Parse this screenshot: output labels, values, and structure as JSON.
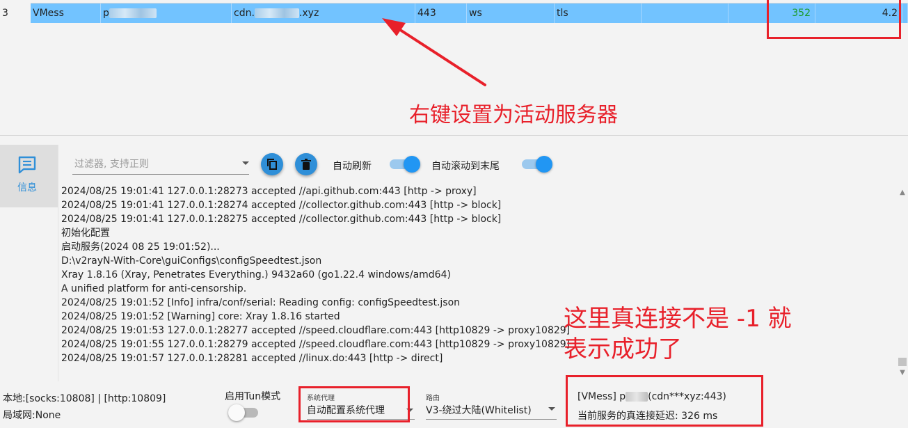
{
  "server_row": {
    "index": "3",
    "type": "VMess",
    "remarks_prefix": "p",
    "address_prefix": "cdn.",
    "address_suffix": "xyz",
    "port": "443",
    "network": "ws",
    "security": "tls",
    "delay_ms": "352",
    "speed": "4.2"
  },
  "annotations": {
    "set_active": "右键设置为活动服务器",
    "real_delay_note_line1": "这里真连接不是 -1 就",
    "real_delay_note_line2": "表示成功了",
    "color": "#e8202a"
  },
  "nav": {
    "info_label": "信息",
    "info_icon": "message-icon",
    "accent": "#2f8fd8"
  },
  "toolbar": {
    "filter_placeholder": "过滤器, 支持正则",
    "copy_icon": "copy-icon",
    "delete_icon": "trash-icon",
    "auto_refresh_label": "自动刷新",
    "auto_refresh_on": true,
    "auto_scroll_label": "自动滚动到末尾",
    "auto_scroll_on": true
  },
  "log_lines": [
    "2024/08/25 19:01:41 127.0.0.1:28273 accepted //api.github.com:443 [http -> proxy]",
    "2024/08/25 19:01:41 127.0.0.1:28274 accepted //collector.github.com:443 [http -> block]",
    "2024/08/25 19:01:41 127.0.0.1:28275 accepted //collector.github.com:443 [http -> block]",
    "初始化配置",
    "启动服务(2024 08 25 19:01:52)...",
    "D:\\v2rayN-With-Core\\guiConfigs\\configSpeedtest.json",
    "Xray 1.8.16 (Xray, Penetrates Everything.) 9432a60 (go1.22.4 windows/amd64)",
    "A unified platform for anti-censorship.",
    "2024/08/25 19:01:52 [Info] infra/conf/serial: Reading config: configSpeedtest.json",
    "2024/08/25 19:01:52 [Warning] core: Xray 1.8.16 started",
    "2024/08/25 19:01:53 127.0.0.1:28277 accepted //speed.cloudflare.com:443 [http10829 -> proxy10829]",
    "2024/08/25 19:01:55 127.0.0.1:28279 accepted //speed.cloudflare.com:443 [http10829 -> proxy10829]",
    "2024/08/25 19:01:57 127.0.0.1:28281 accepted //linux.do:443 [http -> direct]"
  ],
  "status_bar": {
    "local_ports": "本地:[socks:10808] | [http:10809]",
    "lan": "局域网:None",
    "tun_label": "启用Tun模式",
    "tun_on": false,
    "sysproxy_caption": "系统代理",
    "sysproxy_value": "自动配置系统代理",
    "routing_caption": "路由",
    "routing_value": "V3-绕过大陆(Whitelist)",
    "active_server_prefix": "[VMess] p",
    "active_server_suffix": "(cdn***xyz:443)",
    "real_delay": "当前服务的真连接延迟: 326 ms"
  }
}
